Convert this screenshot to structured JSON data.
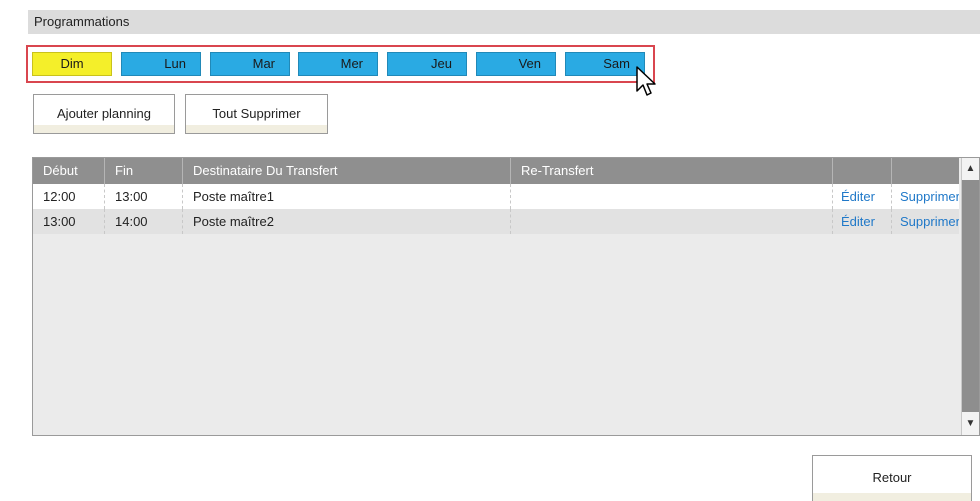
{
  "section_title": "Programmations",
  "days": [
    {
      "label": "Dim",
      "active": true
    },
    {
      "label": "Lun",
      "active": false
    },
    {
      "label": "Mar",
      "active": false
    },
    {
      "label": "Mer",
      "active": false
    },
    {
      "label": "Jeu",
      "active": false
    },
    {
      "label": "Ven",
      "active": false
    },
    {
      "label": "Sam",
      "active": false
    }
  ],
  "actions": {
    "add_label": "Ajouter planning",
    "delete_all_label": "Tout Supprimer"
  },
  "table": {
    "headers": [
      "Début",
      "Fin",
      "Destinataire Du Transfert",
      "Re-Transfert",
      "",
      ""
    ],
    "rows": [
      {
        "start": "12:00",
        "end": "13:00",
        "dest": "Poste maître1",
        "retransfer": "",
        "edit": "Éditer",
        "delete": "Supprimer"
      },
      {
        "start": "13:00",
        "end": "14:00",
        "dest": "Poste maître2",
        "retransfer": "",
        "edit": "Éditer",
        "delete": "Supprimer"
      }
    ]
  },
  "scroll": {
    "up_icon": "▲",
    "down_icon": "▼"
  },
  "footer": {
    "back_label": "Retour"
  },
  "colors": {
    "day_active": "#f4ef2a",
    "day": "#2aaae3",
    "frame": "#d9464f",
    "link": "#1f78c8"
  }
}
